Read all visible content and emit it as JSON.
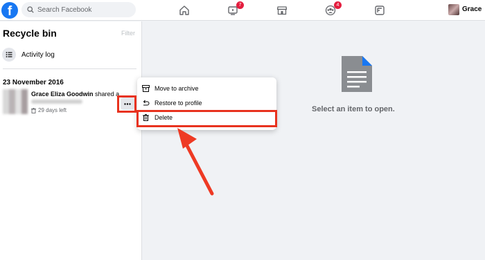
{
  "topbar": {
    "logo": "f",
    "search_placeholder": "Search Facebook",
    "nav": [
      {
        "icon": "home-icon"
      },
      {
        "icon": "watch-icon",
        "badge": "7"
      },
      {
        "icon": "marketplace-icon"
      },
      {
        "icon": "groups-icon",
        "badge": "4"
      },
      {
        "icon": "gaming-icon"
      }
    ],
    "user_name": "Grace"
  },
  "sidebar": {
    "title": "Recycle bin",
    "filter_label": "Filter",
    "activity_log_label": "Activity log",
    "date_header": "23 November 2016",
    "post": {
      "author": "Grace Eliza Goodwin",
      "action": "shared a link.",
      "days_left": "29 days left"
    }
  },
  "menu": {
    "items": [
      {
        "label": "Move to archive",
        "icon": "archive-icon"
      },
      {
        "label": "Restore to profile",
        "icon": "restore-icon"
      },
      {
        "label": "Delete",
        "icon": "trash-icon"
      }
    ]
  },
  "main": {
    "empty_message": "Select an item to open."
  },
  "colors": {
    "brand": "#1877f2",
    "highlight": "#e8321e",
    "badge": "#e41e3f"
  }
}
